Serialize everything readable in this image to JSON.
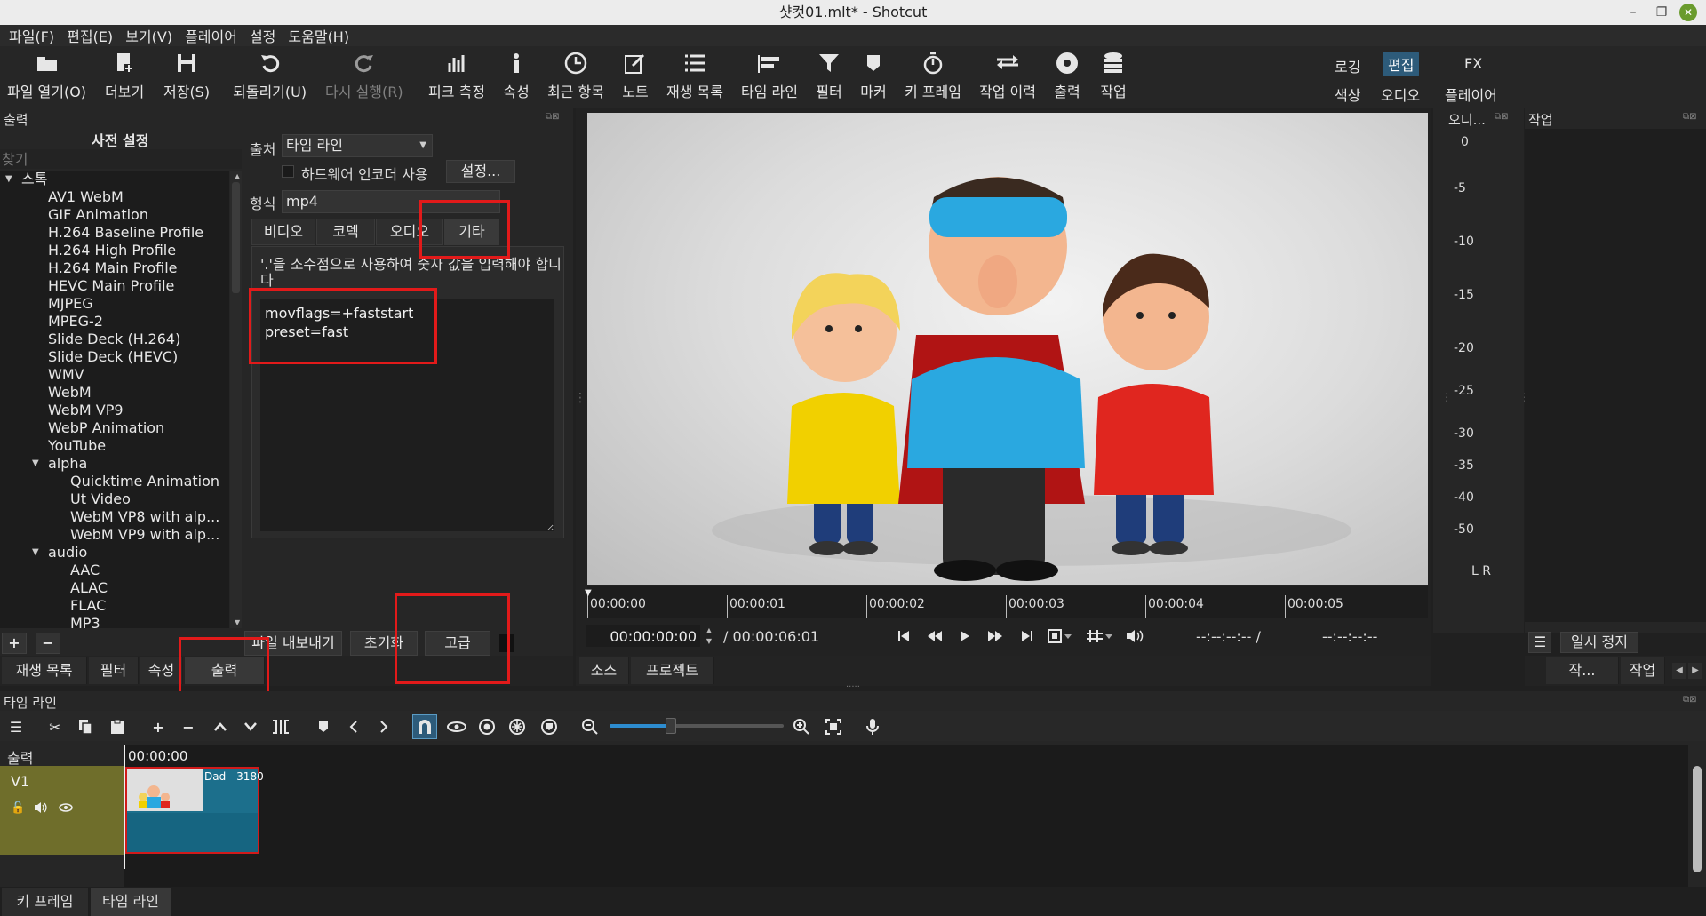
{
  "window": {
    "title": "샷컷01.mlt* - Shotcut",
    "min": "–",
    "max": "❐",
    "close": "✕"
  },
  "menu": [
    "파일(F)",
    "편집(E)",
    "보기(V)",
    "플레이어",
    "설정",
    "도움말(H)"
  ],
  "toolbar": {
    "open": "파일 열기(O)",
    "more": "더보기",
    "save": "저장(S)",
    "undo": "되돌리기(U)",
    "redo": "다시 실행(R)",
    "peak": "피크 측정",
    "props": "속성",
    "recent": "최근 항목",
    "notes": "노트",
    "playlist": "재생 목록",
    "timeline": "타임 라인",
    "filters": "필터",
    "markers": "마커",
    "keyframes": "키 프레임",
    "history": "작업 이력",
    "export": "출력",
    "jobs": "작업"
  },
  "layouts": {
    "logging": "로깅",
    "editing": "편집",
    "fx": "FX",
    "color": "색상",
    "audio": "오디오",
    "player": "플레이어"
  },
  "export_panel": {
    "title": "출력",
    "presets_title": "사전 설정",
    "search_placeholder": "찾기",
    "tree": [
      {
        "label": "스톡",
        "level": 0,
        "expanded": true
      },
      {
        "label": "AV1 WebM",
        "level": 1
      },
      {
        "label": "GIF Animation",
        "level": 1
      },
      {
        "label": "H.264 Baseline Profile",
        "level": 1
      },
      {
        "label": "H.264 High Profile",
        "level": 1
      },
      {
        "label": "H.264 Main Profile",
        "level": 1
      },
      {
        "label": "HEVC Main Profile",
        "level": 1
      },
      {
        "label": "MJPEG",
        "level": 1
      },
      {
        "label": "MPEG-2",
        "level": 1
      },
      {
        "label": "Slide Deck (H.264)",
        "level": 1
      },
      {
        "label": "Slide Deck (HEVC)",
        "level": 1
      },
      {
        "label": "WMV",
        "level": 1
      },
      {
        "label": "WebM",
        "level": 1
      },
      {
        "label": "WebM VP9",
        "level": 1
      },
      {
        "label": "WebP Animation",
        "level": 1
      },
      {
        "label": "YouTube",
        "level": 1
      },
      {
        "label": "alpha",
        "level": 1,
        "expanded": true
      },
      {
        "label": "Quicktime Animation",
        "level": 2
      },
      {
        "label": "Ut Video",
        "level": 2
      },
      {
        "label": "WebM VP8 with alp...",
        "level": 2
      },
      {
        "label": "WebM VP9 with alp...",
        "level": 2
      },
      {
        "label": "audio",
        "level": 1,
        "expanded": true
      },
      {
        "label": "AAC",
        "level": 2
      },
      {
        "label": "ALAC",
        "level": 2
      },
      {
        "label": "FLAC",
        "level": 2
      },
      {
        "label": "MP3",
        "level": 2
      }
    ],
    "from_label": "출처",
    "from_value": "타임 라인",
    "hw_encoder_label": "하드웨어 인코더 사용",
    "configure_button": "설정...",
    "format_label": "형식",
    "format_value": "mp4",
    "tabs": [
      "비디오",
      "코덱",
      "오디오",
      "기타"
    ],
    "active_tab": "기타",
    "other_hint": "'.'을 소수점으로 사용하여 숫자 값을 입력해야 합니다",
    "other_text": "movflags=+faststart\npreset=fast",
    "add_preset": "+",
    "remove_preset": "−",
    "export_file_button": "파일 내보내기",
    "reset_button": "초기화",
    "advanced_button": "고급"
  },
  "left_tabs": [
    "재생 목록",
    "필터",
    "속성",
    "출력"
  ],
  "player": {
    "ruler": [
      "00:00:00",
      "00:00:01",
      "00:00:02",
      "00:00:03",
      "00:00:04",
      "00:00:05"
    ],
    "timecode": "00:00:00:00",
    "duration": "/ 00:00:06:01",
    "in_point": "--:--:--:-- /",
    "out_point": "--:--:--:--",
    "tabs": [
      "소스",
      "프로젝트"
    ]
  },
  "meter": {
    "title": "오디...",
    "labels": [
      "0",
      "-5",
      "-10",
      "-15",
      "-20",
      "-25",
      "-30",
      "-35",
      "-40",
      "-50"
    ],
    "channels": "L R"
  },
  "jobs": {
    "title": "작업",
    "pause_button": "일시 정지",
    "tab_jobs_short": "작...",
    "tab_jobs": "작업"
  },
  "timeline": {
    "title": "타임 라인",
    "output_label": "출력",
    "time_start": "00:00:00",
    "track_name": "V1",
    "clip_name": "Dad - 3180",
    "zoom_level": 0.35
  },
  "bottom_tabs": [
    "키 프레임",
    "타임 라인"
  ],
  "colors": {
    "accent": "#2d5b7a",
    "highlight_box": "#e21a1a",
    "track_head": "#6f6e2b",
    "clip": "#1c6f8c"
  }
}
